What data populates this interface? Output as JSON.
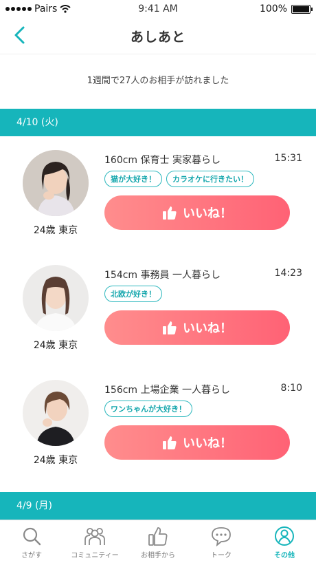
{
  "status_bar": {
    "carrier": "Pairs",
    "time": "9:41 AM",
    "battery": "100%"
  },
  "header": {
    "title": "あしあと"
  },
  "summary": "1週間で27人のお相手が訪れました",
  "sections": [
    {
      "date": "4/10 (火)"
    },
    {
      "date": "4/9 (月)"
    }
  ],
  "visitors": [
    {
      "profile": "160cm 保育士 実家暮らし",
      "time": "15:31",
      "tags": [
        "猫が大好き！",
        "カラオケに行きたい！"
      ],
      "age_area": "24歳 東京",
      "like_label": "いいね！"
    },
    {
      "profile": "154cm 事務員 一人暮らし",
      "time": "14:23",
      "tags": [
        "北欧が好き！"
      ],
      "age_area": "24歳 東京",
      "like_label": "いいね！"
    },
    {
      "profile": "156cm 上場企業 一人暮らし",
      "time": "8:10",
      "tags": [
        "ワンちゃんが大好き！"
      ],
      "age_area": "24歳 東京",
      "like_label": "いいね！"
    }
  ],
  "tabbar": {
    "items": [
      {
        "label": "さがす",
        "icon": "search-icon"
      },
      {
        "label": "コミュニティー",
        "icon": "community-icon"
      },
      {
        "label": "お相手から",
        "icon": "thumbs-up-icon"
      },
      {
        "label": "トーク",
        "icon": "chat-icon"
      },
      {
        "label": "その他",
        "icon": "profile-icon"
      }
    ],
    "active_index": 4
  },
  "colors": {
    "accent": "#16b5bb",
    "like_start": "#ff8d8d",
    "like_end": "#ff6275"
  }
}
